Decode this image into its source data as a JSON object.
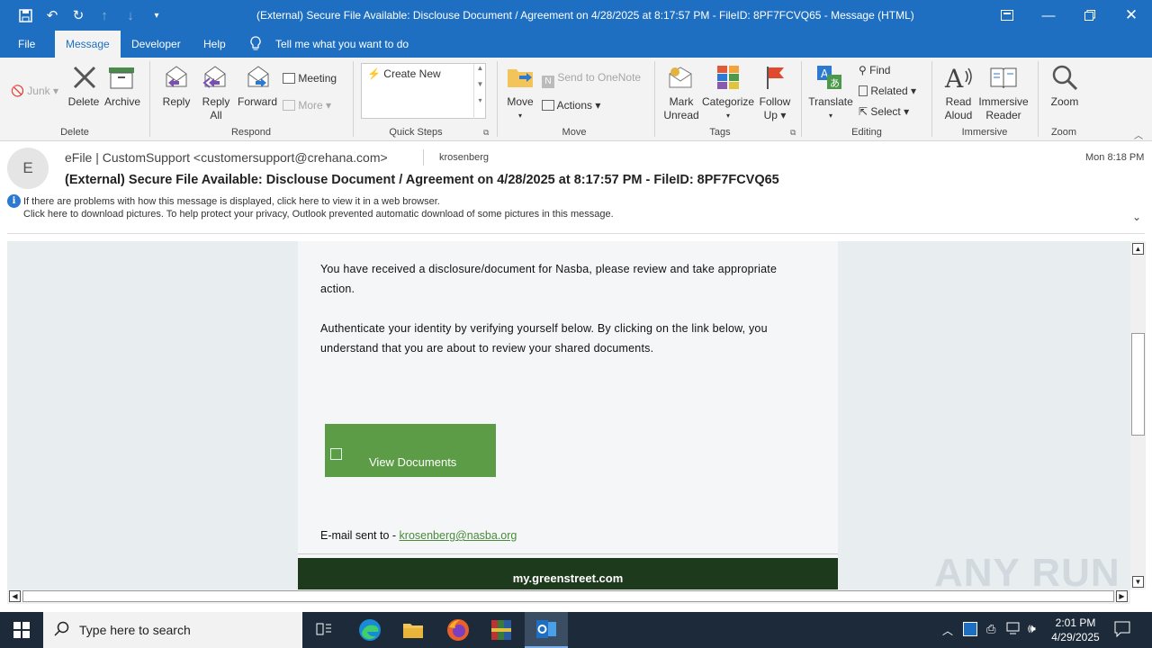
{
  "window": {
    "title": "(External) Secure File Available: Disclouse Document / Agreement on 4/28/2025 at 8:17:57 PM - FileID: 8PF7FCVQ65  -  Message (HTML)"
  },
  "tabs": [
    "File",
    "Message",
    "Developer",
    "Help"
  ],
  "tell_me": "Tell me what you want to do",
  "ribbon": {
    "junk": "Junk",
    "delete": "Delete",
    "archive": "Archive",
    "reply": "Reply",
    "reply_all_1": "Reply",
    "reply_all_2": "All",
    "forward": "Forward",
    "meeting": "Meeting",
    "more": "More",
    "create_new": "Create New",
    "move": "Move",
    "send_onenote": "Send to OneNote",
    "actions": "Actions",
    "mark_unread_1": "Mark",
    "mark_unread_2": "Unread",
    "categorize": "Categorize",
    "follow_up_1": "Follow",
    "follow_up_2": "Up",
    "translate": "Translate",
    "find": "Find",
    "related": "Related",
    "select": "Select",
    "read_aloud_1": "Read",
    "read_aloud_2": "Aloud",
    "immersive_1": "Immersive",
    "immersive_2": "Reader",
    "zoom": "Zoom",
    "groups": {
      "delete": "Delete",
      "respond": "Respond",
      "quick_steps": "Quick Steps",
      "move": "Move",
      "tags": "Tags",
      "editing": "Editing",
      "immersive": "Immersive",
      "zoom": "Zoom"
    }
  },
  "message": {
    "avatar_letter": "E",
    "sender": "eFile | CustomSupport <customersupport@crehana.com>",
    "to": "krosenberg",
    "date": "Mon 8:18 PM",
    "subject": "(External) Secure File Available: Disclouse Document / Agreement on 4/28/2025 at 8:17:57 PM - FileID: 8PF7FCVQ65",
    "info_line1": "If there are problems with how this message is displayed, click here to view it in a web browser.",
    "info_line2": "Click here to download pictures. To help protect your privacy, Outlook prevented automatic download of some pictures in this message."
  },
  "email": {
    "para1": "You have received a disclosure/document for Nasba, please review and take appropriate action.",
    "para2": "Authenticate your identity by verifying yourself below. By clicking on the link below, you understand that you are about to review your shared documents.",
    "button": "View Documents",
    "sent_to_label": "E-mail sent to - ",
    "sent_to_email": "krosenberg@nasba.org",
    "footer": "my.greenstreet.com"
  },
  "watermark": "ANY RUN",
  "taskbar": {
    "search_placeholder": "Type here to search",
    "time": "2:01 PM",
    "date": "4/29/2025"
  },
  "colors": {
    "titlebar": "#1e6fc1",
    "button_green": "#5c9c46",
    "footer_green": "#1e3a1c",
    "taskbar": "#1c2a3a"
  }
}
